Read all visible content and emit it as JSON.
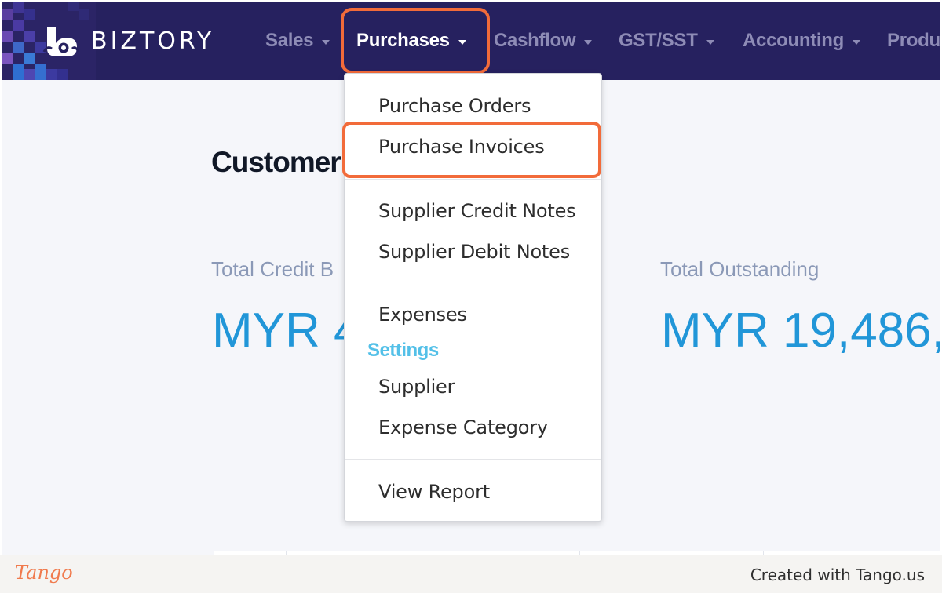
{
  "navbar": {
    "brand": "BIZTORY",
    "items": [
      {
        "label": "Sales"
      },
      {
        "label": "Purchases"
      },
      {
        "label": "Cashflow"
      },
      {
        "label": "GST/SST"
      },
      {
        "label": "Accounting"
      },
      {
        "label": "Produ"
      }
    ],
    "active_item": "Purchases",
    "colors": {
      "background": "#26215f",
      "inactive_text": "#8e8cb6",
      "active_text": "#ffffff"
    }
  },
  "page": {
    "title": "Customer",
    "stats": [
      {
        "label": "Total Credit B",
        "value": "MYR 4"
      },
      {
        "label": "Total Outstanding",
        "value": "MYR 19,486,"
      }
    ]
  },
  "dropdown": {
    "items": {
      "purchase_orders": "Purchase Orders",
      "purchase_invoices": "Purchase Invoices",
      "supplier_credit_notes": "Supplier Credit Notes",
      "supplier_debit_notes": "Supplier Debit Notes",
      "expenses": "Expenses",
      "settings_header": "Settings",
      "supplier": "Supplier",
      "expense_category": "Expense Category",
      "view_report": "View Report"
    },
    "highlighted": "Purchase Invoices"
  },
  "highlight_color": "#f26b3a",
  "footer": {
    "logo": "Tango",
    "text": "Created with Tango.us"
  }
}
